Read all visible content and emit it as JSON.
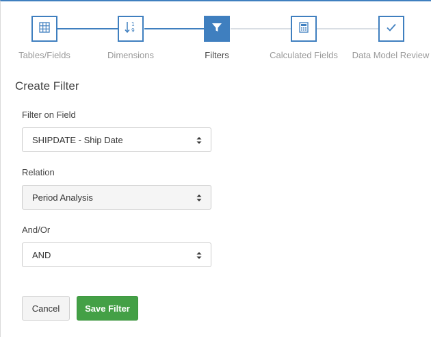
{
  "colors": {
    "accent": "#3f7fbf",
    "inactive_line": "#d9dee4",
    "save": "#44a046"
  },
  "stepper": {
    "steps": [
      {
        "label": "Tables/Fields",
        "icon": "table-icon",
        "state": "complete"
      },
      {
        "label": "Dimensions",
        "icon": "sort-numeric-icon",
        "state": "complete"
      },
      {
        "label": "Filters",
        "icon": "filter-icon",
        "state": "active"
      },
      {
        "label": "Calculated Fields",
        "icon": "calculator-icon",
        "state": "pending"
      },
      {
        "label": "Data Model Review",
        "icon": "checkmark-icon",
        "state": "pending"
      }
    ]
  },
  "form": {
    "title": "Create Filter",
    "filter_field": {
      "label": "Filter on Field",
      "value": "SHIPDATE - Ship Date"
    },
    "relation": {
      "label": "Relation",
      "value": "Period Analysis"
    },
    "and_or": {
      "label": "And/Or",
      "value": "AND"
    },
    "cancel_label": "Cancel",
    "save_label": "Save Filter"
  }
}
